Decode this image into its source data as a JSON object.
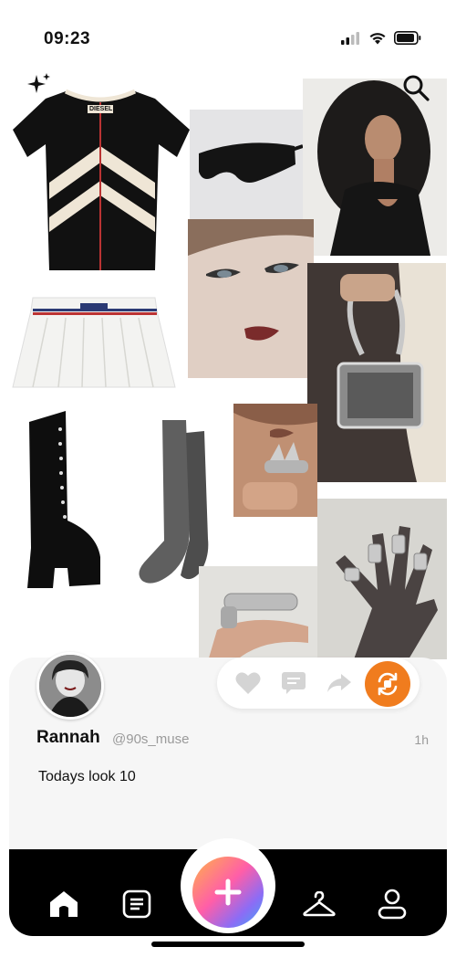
{
  "status_bar": {
    "time": "09:23"
  },
  "collage": {
    "items": [
      {
        "name": "black-diesel-tshirt",
        "brand_label": "DIESEL"
      },
      {
        "name": "black-wrap-sunglasses"
      },
      {
        "name": "curly-hair-model-photo"
      },
      {
        "name": "winged-eyeliner-face-photo"
      },
      {
        "name": "white-pleated-miniskirt"
      },
      {
        "name": "silver-box-handbag-photo"
      },
      {
        "name": "lace-up-platform-boots"
      },
      {
        "name": "grey-knee-socks"
      },
      {
        "name": "spike-ring-photo"
      },
      {
        "name": "silver-armor-rings-hand-photo"
      },
      {
        "name": "armor-ring-finger-photo"
      }
    ]
  },
  "post": {
    "username": "Rannah",
    "handle": "@90s_muse",
    "time_ago": "1h",
    "caption": "Todays look 10"
  },
  "actions": {
    "icons": [
      "heart-icon",
      "comment-icon",
      "share-icon",
      "remix-icon"
    ]
  },
  "nav": {
    "items": [
      "home-icon",
      "feed-icon",
      "create-icon",
      "wardrobe-icon",
      "profile-icon"
    ]
  },
  "colors": {
    "accent_orange": "#f07c1e",
    "card_bg": "#f6f6f6",
    "nav_bg": "#000000"
  }
}
